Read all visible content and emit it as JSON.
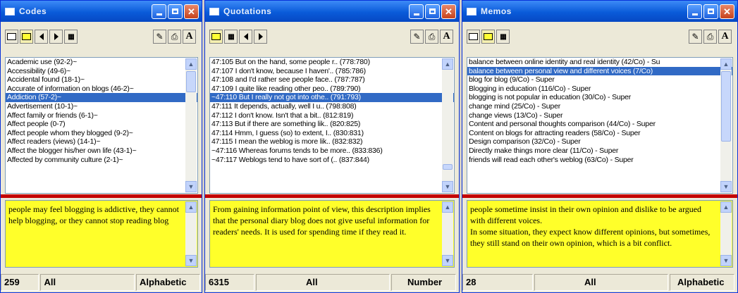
{
  "windows": [
    {
      "title": "Codes",
      "list": [
        "Academic use (92-2)~",
        "Accessibility (49-6)~",
        "Accidental found (18-1)~",
        "Accurate of information on blogs (46-2)~",
        "Addiction (57-2)~",
        "Advertisement (10-1)~",
        "Affect family or friends (6-1)~",
        "Affect people (0-7)",
        "Affect people whom they blogged (9-2)~",
        "Affect readers (views) (14-1)~",
        "Affect the blogger his/her own life (43-1)~",
        "Affected by community culture (2-1)~"
      ],
      "selected_index": 4,
      "note": "people may feel blogging is addictive, they cannot help blogging, or they cannot stop reading blog",
      "status": {
        "count": "259",
        "filter": "All",
        "sort": "Alphabetic"
      }
    },
    {
      "title": "Quotations",
      "list": [
        "47:105 But on the hand, some people r.. (778:780)",
        "47:107 I don't know, because I haven'.. (785:786)",
        "47:108 and I'd rather see people face.. (787:787)",
        "47:109 I quite like reading other peo.. (789:790)",
        "~47:110 But I really not got into othe.. (791:793)",
        "47:111 It depends, actually, well I u.. (798:808)",
        "47:112 I don't know. Isn't that a bit.. (812:819)",
        "47:113 But if there are something lik.. (820:825)",
        "47:114 Hmm, I guess (so) to extent, I.. (830:831)",
        "47:115 I mean the weblog is more lik.. (832:832)",
        "~47:116 Whereas forums tends to be more.. (833:836)",
        "~47:117 Weblogs tend to have sort of (.. (837:844)"
      ],
      "selected_index": 4,
      "note": "From gaining information point of view, this description implies that the personal diary blog does not give useful information for readers' needs. It is used for spending time if they read it.",
      "status": {
        "count": "6315",
        "filter": "All",
        "sort": "Number"
      }
    },
    {
      "title": "Memos",
      "list": [
        "balance between online identity and real identity (42/Co) - Su",
        "balance between personal view and different voices (7/Co)",
        "blog for blog (9/Co) - Super",
        "Blogging in education (116/Co) - Super",
        "blogging is not popular in education (30/Co) - Super",
        "change mind (25/Co) - Super",
        "change views (13/Co) - Super",
        "Content and personal thoughts comparison (44/Co) - Super",
        "Content on blogs for attracting readers (58/Co) - Super",
        "Design comparison (32/Co) - Super",
        "Directly make things more clear (11/Co) - Super",
        "friends will read each other's weblog (63/Co) - Super"
      ],
      "selected_index": 1,
      "note": "people sometime insist in their own opinion and dislike to be argued with different voices.\nIn some situation, they expect know different opinions, but sometimes, they still stand on their own opinion, which is a bit conflict.",
      "status": {
        "count": "28",
        "filter": "All",
        "sort": "Alphabetic"
      }
    }
  ],
  "colors": {
    "title_bar": "#0a5bd9",
    "selection": "#316ac5",
    "note_bg": "#ffff2a",
    "divider": "#c40000"
  }
}
